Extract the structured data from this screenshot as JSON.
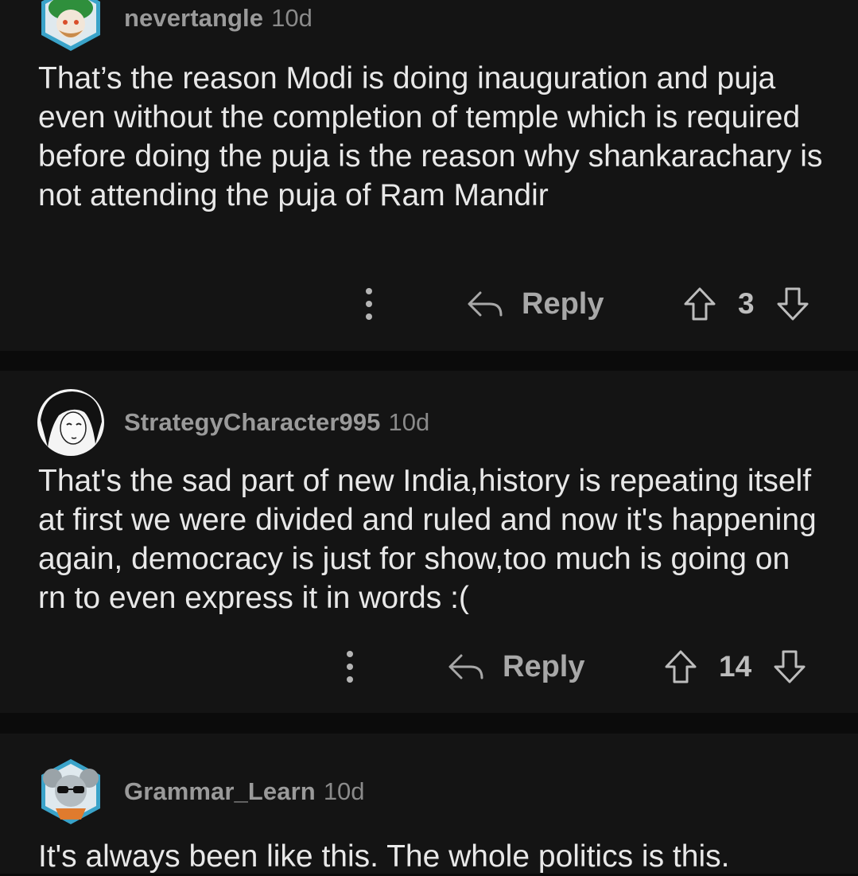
{
  "comments": [
    {
      "username": "nevertangle",
      "age": "10d",
      "avatar": "snoo-avatar-turban",
      "text": "That’s the reason Modi is doing inauguration and puja even without the completion of temple which is required before doing the puja is the reason why shankarachary is not attending the puja of Ram Mandir",
      "reply_label": "Reply",
      "score": "3"
    },
    {
      "username": "StrategyCharacter995",
      "age": "10d",
      "avatar": "anime-avatar",
      "text": "That's the sad part of new India,history is repeating itself at first we were divided and ruled and now it's happening again, democracy is just for show,too much is going on rn to even express it in words :(",
      "reply_label": "Reply",
      "score": "14"
    },
    {
      "username": "Grammar_Learn",
      "age": "10d",
      "avatar": "snoo-avatar-koala",
      "text": "It's always been like this. The whole politics is this."
    }
  ],
  "colors": {
    "background": "#0b0b0b",
    "card": "#141414",
    "text": "#e8e8e8",
    "meta": "#9a9a9a"
  },
  "icons": [
    "more-vertical-icon",
    "reply-arrow-icon",
    "upvote-arrow-icon",
    "downvote-arrow-icon"
  ]
}
